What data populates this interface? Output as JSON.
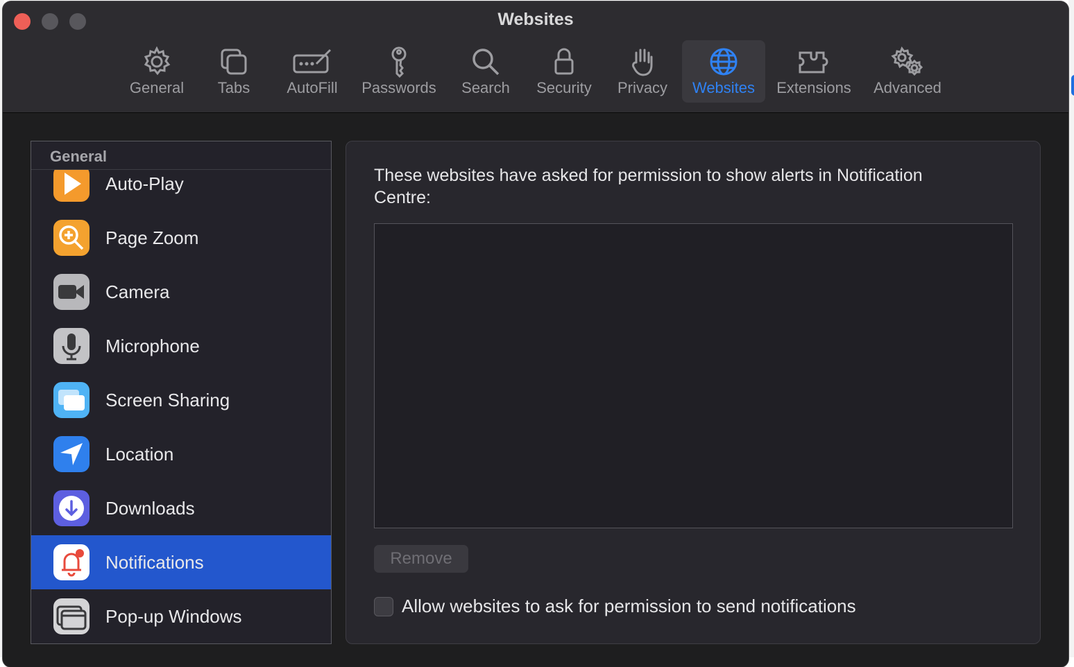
{
  "window": {
    "title": "Websites"
  },
  "toolbar": {
    "items": [
      {
        "label": "General",
        "icon": "gear-icon",
        "active": false
      },
      {
        "label": "Tabs",
        "icon": "tabs-icon",
        "active": false
      },
      {
        "label": "AutoFill",
        "icon": "autofill-icon",
        "active": false
      },
      {
        "label": "Passwords",
        "icon": "key-icon",
        "active": false
      },
      {
        "label": "Search",
        "icon": "search-icon",
        "active": false
      },
      {
        "label": "Security",
        "icon": "lock-icon",
        "active": false
      },
      {
        "label": "Privacy",
        "icon": "hand-icon",
        "active": false
      },
      {
        "label": "Websites",
        "icon": "globe-icon",
        "active": true
      },
      {
        "label": "Extensions",
        "icon": "puzzle-icon",
        "active": false
      },
      {
        "label": "Advanced",
        "icon": "gears-icon",
        "active": false
      }
    ],
    "accent_color": "#2f82f4"
  },
  "sidebar": {
    "header": "General",
    "items": [
      {
        "label": "Auto-Play",
        "icon": "play-icon",
        "selected": false
      },
      {
        "label": "Page Zoom",
        "icon": "zoom-icon",
        "selected": false
      },
      {
        "label": "Camera",
        "icon": "camera-icon",
        "selected": false
      },
      {
        "label": "Microphone",
        "icon": "microphone-icon",
        "selected": false
      },
      {
        "label": "Screen Sharing",
        "icon": "screen-sharing-icon",
        "selected": false
      },
      {
        "label": "Location",
        "icon": "location-icon",
        "selected": false
      },
      {
        "label": "Downloads",
        "icon": "download-icon",
        "selected": false
      },
      {
        "label": "Notifications",
        "icon": "bell-icon",
        "selected": true
      },
      {
        "label": "Pop-up Windows",
        "icon": "popup-window-icon",
        "selected": false
      }
    ],
    "selected_color": "#2357cd"
  },
  "main": {
    "description": "These websites have asked for permission to show alerts in Notification Centre:",
    "remove_label": "Remove",
    "allow_label": "Allow websites to ask for permission to send notifications",
    "allow_checked": false
  }
}
